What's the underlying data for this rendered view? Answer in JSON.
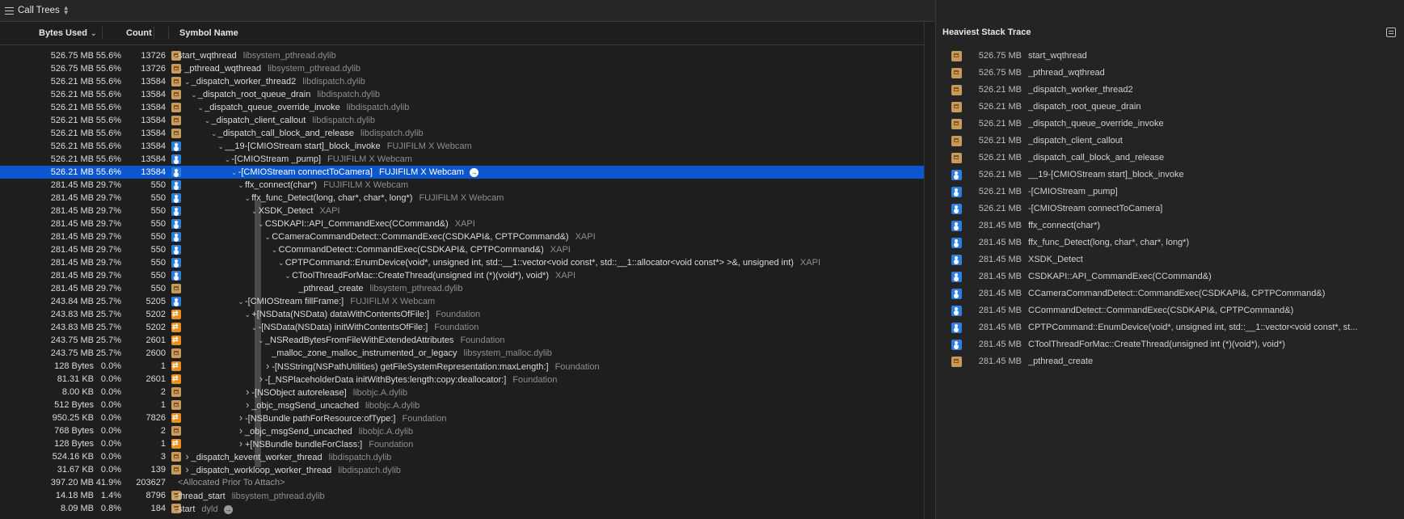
{
  "toolbar": {
    "title": "Call Trees"
  },
  "columns": {
    "bytes": "Bytes Used",
    "count": "Count",
    "symbol": "Symbol Name"
  },
  "rows": [
    {
      "bytes": "526.75 MB",
      "pct": "55.6%",
      "count": "13726",
      "icon": "system-lib-icon",
      "disc": "open",
      "depth": 0,
      "symbol": "start_wqthread",
      "lib": "libsystem_pthread.dylib"
    },
    {
      "bytes": "526.75 MB",
      "pct": "55.6%",
      "count": "13726",
      "icon": "system-lib-icon",
      "disc": "open",
      "depth": 1,
      "symbol": "_pthread_wqthread",
      "lib": "libsystem_pthread.dylib"
    },
    {
      "bytes": "526.21 MB",
      "pct": "55.6%",
      "count": "13584",
      "icon": "system-lib-icon",
      "disc": "open",
      "depth": 2,
      "symbol": "_dispatch_worker_thread2",
      "lib": "libdispatch.dylib"
    },
    {
      "bytes": "526.21 MB",
      "pct": "55.6%",
      "count": "13584",
      "icon": "system-lib-icon",
      "disc": "open",
      "depth": 3,
      "symbol": "_dispatch_root_queue_drain",
      "lib": "libdispatch.dylib"
    },
    {
      "bytes": "526.21 MB",
      "pct": "55.6%",
      "count": "13584",
      "icon": "system-lib-icon",
      "disc": "open",
      "depth": 4,
      "symbol": "_dispatch_queue_override_invoke",
      "lib": "libdispatch.dylib"
    },
    {
      "bytes": "526.21 MB",
      "pct": "55.6%",
      "count": "13584",
      "icon": "system-lib-icon",
      "disc": "open",
      "depth": 5,
      "symbol": "_dispatch_client_callout",
      "lib": "libdispatch.dylib"
    },
    {
      "bytes": "526.21 MB",
      "pct": "55.6%",
      "count": "13584",
      "icon": "system-lib-icon",
      "disc": "open",
      "depth": 6,
      "symbol": "_dispatch_call_block_and_release",
      "lib": "libdispatch.dylib"
    },
    {
      "bytes": "526.21 MB",
      "pct": "55.6%",
      "count": "13584",
      "icon": "user-code-icon",
      "disc": "open",
      "depth": 7,
      "symbol": "__19-[CMIOStream start]_block_invoke",
      "lib": "FUJIFILM X Webcam"
    },
    {
      "bytes": "526.21 MB",
      "pct": "55.6%",
      "count": "13584",
      "icon": "user-code-icon",
      "disc": "open",
      "depth": 8,
      "symbol": "-[CMIOStream _pump]",
      "lib": "FUJIFILM X Webcam"
    },
    {
      "bytes": "526.21 MB",
      "pct": "55.6%",
      "count": "13584",
      "icon": "user-code-icon",
      "disc": "open",
      "depth": 9,
      "symbol": "-[CMIOStream connectToCamera]",
      "lib": "FUJIFILM X Webcam",
      "selected": true,
      "arrow": "white"
    },
    {
      "bytes": "281.45 MB",
      "pct": "29.7%",
      "count": "550",
      "icon": "user-code-icon",
      "disc": "open",
      "depth": 10,
      "symbol": "ffx_connect(char*)",
      "lib": "FUJIFILM X Webcam"
    },
    {
      "bytes": "281.45 MB",
      "pct": "29.7%",
      "count": "550",
      "icon": "user-code-icon",
      "disc": "open",
      "depth": 11,
      "symbol": "ffx_func_Detect(long, char*, char*, long*)",
      "lib": "FUJIFILM X Webcam"
    },
    {
      "bytes": "281.45 MB",
      "pct": "29.7%",
      "count": "550",
      "icon": "user-code-icon",
      "disc": "open",
      "depth": 12,
      "symbol": "XSDK_Detect",
      "lib": "XAPI"
    },
    {
      "bytes": "281.45 MB",
      "pct": "29.7%",
      "count": "550",
      "icon": "user-code-icon",
      "disc": "open",
      "depth": 13,
      "symbol": "CSDKAPI::API_CommandExec(CCommand&)",
      "lib": "XAPI"
    },
    {
      "bytes": "281.45 MB",
      "pct": "29.7%",
      "count": "550",
      "icon": "user-code-icon",
      "disc": "open",
      "depth": 14,
      "symbol": "CCameraCommandDetect::CommandExec(CSDKAPI&, CPTPCommand&)",
      "lib": "XAPI"
    },
    {
      "bytes": "281.45 MB",
      "pct": "29.7%",
      "count": "550",
      "icon": "user-code-icon",
      "disc": "open",
      "depth": 15,
      "symbol": "CCommandDetect::CommandExec(CSDKAPI&, CPTPCommand&)",
      "lib": "XAPI"
    },
    {
      "bytes": "281.45 MB",
      "pct": "29.7%",
      "count": "550",
      "icon": "user-code-icon",
      "disc": "open",
      "depth": 16,
      "symbol": "CPTPCommand::EnumDevice(void*, unsigned int, std::__1::vector<void const*, std::__1::allocator<void const*> >&, unsigned int)",
      "lib": "XAPI"
    },
    {
      "bytes": "281.45 MB",
      "pct": "29.7%",
      "count": "550",
      "icon": "user-code-icon",
      "disc": "open",
      "depth": 17,
      "symbol": "CToolThreadForMac::CreateThread(unsigned int (*)(void*), void*)",
      "lib": "XAPI"
    },
    {
      "bytes": "281.45 MB",
      "pct": "29.7%",
      "count": "550",
      "icon": "system-lib-icon",
      "disc": "none",
      "depth": 18,
      "symbol": "_pthread_create",
      "lib": "libsystem_pthread.dylib"
    },
    {
      "bytes": "243.84 MB",
      "pct": "25.7%",
      "count": "5205",
      "icon": "user-code-icon",
      "disc": "open",
      "depth": 10,
      "symbol": "-[CMIOStream fillFrame:]",
      "lib": "FUJIFILM X Webcam"
    },
    {
      "bytes": "243.83 MB",
      "pct": "25.7%",
      "count": "5202",
      "icon": "framework-icon",
      "disc": "open",
      "depth": 11,
      "symbol": "+[NSData(NSData) dataWithContentsOfFile:]",
      "lib": "Foundation"
    },
    {
      "bytes": "243.83 MB",
      "pct": "25.7%",
      "count": "5202",
      "icon": "framework-icon",
      "disc": "open",
      "depth": 12,
      "symbol": "-[NSData(NSData) initWithContentsOfFile:]",
      "lib": "Foundation"
    },
    {
      "bytes": "243.75 MB",
      "pct": "25.7%",
      "count": "2601",
      "icon": "framework-icon",
      "disc": "open",
      "depth": 13,
      "symbol": "_NSReadBytesFromFileWithExtendedAttributes",
      "lib": "Foundation"
    },
    {
      "bytes": "243.75 MB",
      "pct": "25.7%",
      "count": "2600",
      "icon": "system-lib-icon",
      "disc": "none",
      "depth": 14,
      "symbol": "_malloc_zone_malloc_instrumented_or_legacy",
      "lib": "libsystem_malloc.dylib"
    },
    {
      "bytes": "128 Bytes",
      "pct": "0.0%",
      "count": "1",
      "icon": "framework-icon",
      "disc": "closed",
      "depth": 14,
      "symbol": "-[NSString(NSPathUtilities) getFileSystemRepresentation:maxLength:]",
      "lib": "Foundation"
    },
    {
      "bytes": "81.31 KB",
      "pct": "0.0%",
      "count": "2601",
      "icon": "framework-icon",
      "disc": "closed",
      "depth": 13,
      "symbol": "-[_NSPlaceholderData initWithBytes:length:copy:deallocator:]",
      "lib": "Foundation"
    },
    {
      "bytes": "8.00 KB",
      "pct": "0.0%",
      "count": "2",
      "icon": "system-lib-icon",
      "disc": "closed",
      "depth": 11,
      "symbol": "-[NSObject autorelease]",
      "lib": "libobjc.A.dylib"
    },
    {
      "bytes": "512 Bytes",
      "pct": "0.0%",
      "count": "1",
      "icon": "system-lib-icon",
      "disc": "closed",
      "depth": 11,
      "symbol": "_objc_msgSend_uncached",
      "lib": "libobjc.A.dylib"
    },
    {
      "bytes": "950.25 KB",
      "pct": "0.0%",
      "count": "7826",
      "icon": "framework-icon",
      "disc": "closed",
      "depth": 10,
      "symbol": "-[NSBundle pathForResource:ofType:]",
      "lib": "Foundation"
    },
    {
      "bytes": "768 Bytes",
      "pct": "0.0%",
      "count": "2",
      "icon": "system-lib-icon",
      "disc": "closed",
      "depth": 10,
      "symbol": "_objc_msgSend_uncached",
      "lib": "libobjc.A.dylib"
    },
    {
      "bytes": "128 Bytes",
      "pct": "0.0%",
      "count": "1",
      "icon": "framework-icon",
      "disc": "closed",
      "depth": 10,
      "symbol": "+[NSBundle bundleForClass:]",
      "lib": "Foundation"
    },
    {
      "bytes": "524.16 KB",
      "pct": "0.0%",
      "count": "3",
      "icon": "system-lib-icon",
      "disc": "closed",
      "depth": 2,
      "symbol": "_dispatch_kevent_worker_thread",
      "lib": "libdispatch.dylib"
    },
    {
      "bytes": "31.67 KB",
      "pct": "0.0%",
      "count": "139",
      "icon": "system-lib-icon",
      "disc": "closed",
      "depth": 2,
      "symbol": "_dispatch_workloop_worker_thread",
      "lib": "libdispatch.dylib"
    },
    {
      "bytes": "397.20 MB",
      "pct": "41.9%",
      "count": "203627",
      "icon": "",
      "disc": "none",
      "depth": 0,
      "symbol": "<Allocated Prior To Attach>",
      "lib": "",
      "dim": true
    },
    {
      "bytes": "14.18 MB",
      "pct": "1.4%",
      "count": "8796",
      "icon": "system-lib-icon",
      "disc": "closed",
      "depth": 0,
      "symbol": "thread_start",
      "lib": "libsystem_pthread.dylib"
    },
    {
      "bytes": "8.09 MB",
      "pct": "0.8%",
      "count": "184",
      "icon": "system-lib-icon",
      "disc": "closed",
      "depth": 0,
      "symbol": "start",
      "lib": "dyld",
      "arrow": "grey"
    }
  ],
  "heaviest": {
    "title": "Heaviest Stack Trace",
    "frames": [
      {
        "icon": "system-lib-icon",
        "bytes": "526.75 MB",
        "symbol": "start_wqthread"
      },
      {
        "icon": "system-lib-icon",
        "bytes": "526.75 MB",
        "symbol": "_pthread_wqthread"
      },
      {
        "icon": "system-lib-icon",
        "bytes": "526.21 MB",
        "symbol": "_dispatch_worker_thread2"
      },
      {
        "icon": "system-lib-icon",
        "bytes": "526.21 MB",
        "symbol": "_dispatch_root_queue_drain"
      },
      {
        "icon": "system-lib-icon",
        "bytes": "526.21 MB",
        "symbol": "_dispatch_queue_override_invoke"
      },
      {
        "icon": "system-lib-icon",
        "bytes": "526.21 MB",
        "symbol": "_dispatch_client_callout"
      },
      {
        "icon": "system-lib-icon",
        "bytes": "526.21 MB",
        "symbol": "_dispatch_call_block_and_release"
      },
      {
        "icon": "user-code-icon",
        "bytes": "526.21 MB",
        "symbol": "__19-[CMIOStream start]_block_invoke"
      },
      {
        "icon": "user-code-icon",
        "bytes": "526.21 MB",
        "symbol": "-[CMIOStream _pump]"
      },
      {
        "icon": "user-code-icon",
        "bytes": "526.21 MB",
        "symbol": "-[CMIOStream connectToCamera]"
      },
      {
        "icon": "user-code-icon",
        "bytes": "281.45 MB",
        "symbol": "ffx_connect(char*)"
      },
      {
        "icon": "user-code-icon",
        "bytes": "281.45 MB",
        "symbol": "ffx_func_Detect(long, char*, char*, long*)"
      },
      {
        "icon": "user-code-icon",
        "bytes": "281.45 MB",
        "symbol": "XSDK_Detect"
      },
      {
        "icon": "user-code-icon",
        "bytes": "281.45 MB",
        "symbol": "CSDKAPI::API_CommandExec(CCommand&)"
      },
      {
        "icon": "user-code-icon",
        "bytes": "281.45 MB",
        "symbol": "CCameraCommandDetect::CommandExec(CSDKAPI&, CPTPCommand&)"
      },
      {
        "icon": "user-code-icon",
        "bytes": "281.45 MB",
        "symbol": "CCommandDetect::CommandExec(CSDKAPI&, CPTPCommand&)"
      },
      {
        "icon": "user-code-icon",
        "bytes": "281.45 MB",
        "symbol": "CPTPCommand::EnumDevice(void*, unsigned int, std::__1::vector<void const*, st..."
      },
      {
        "icon": "user-code-icon",
        "bytes": "281.45 MB",
        "symbol": "CToolThreadForMac::CreateThread(unsigned int (*)(void*), void*)"
      },
      {
        "icon": "system-lib-icon",
        "bytes": "281.45 MB",
        "symbol": "_pthread_create"
      }
    ]
  }
}
